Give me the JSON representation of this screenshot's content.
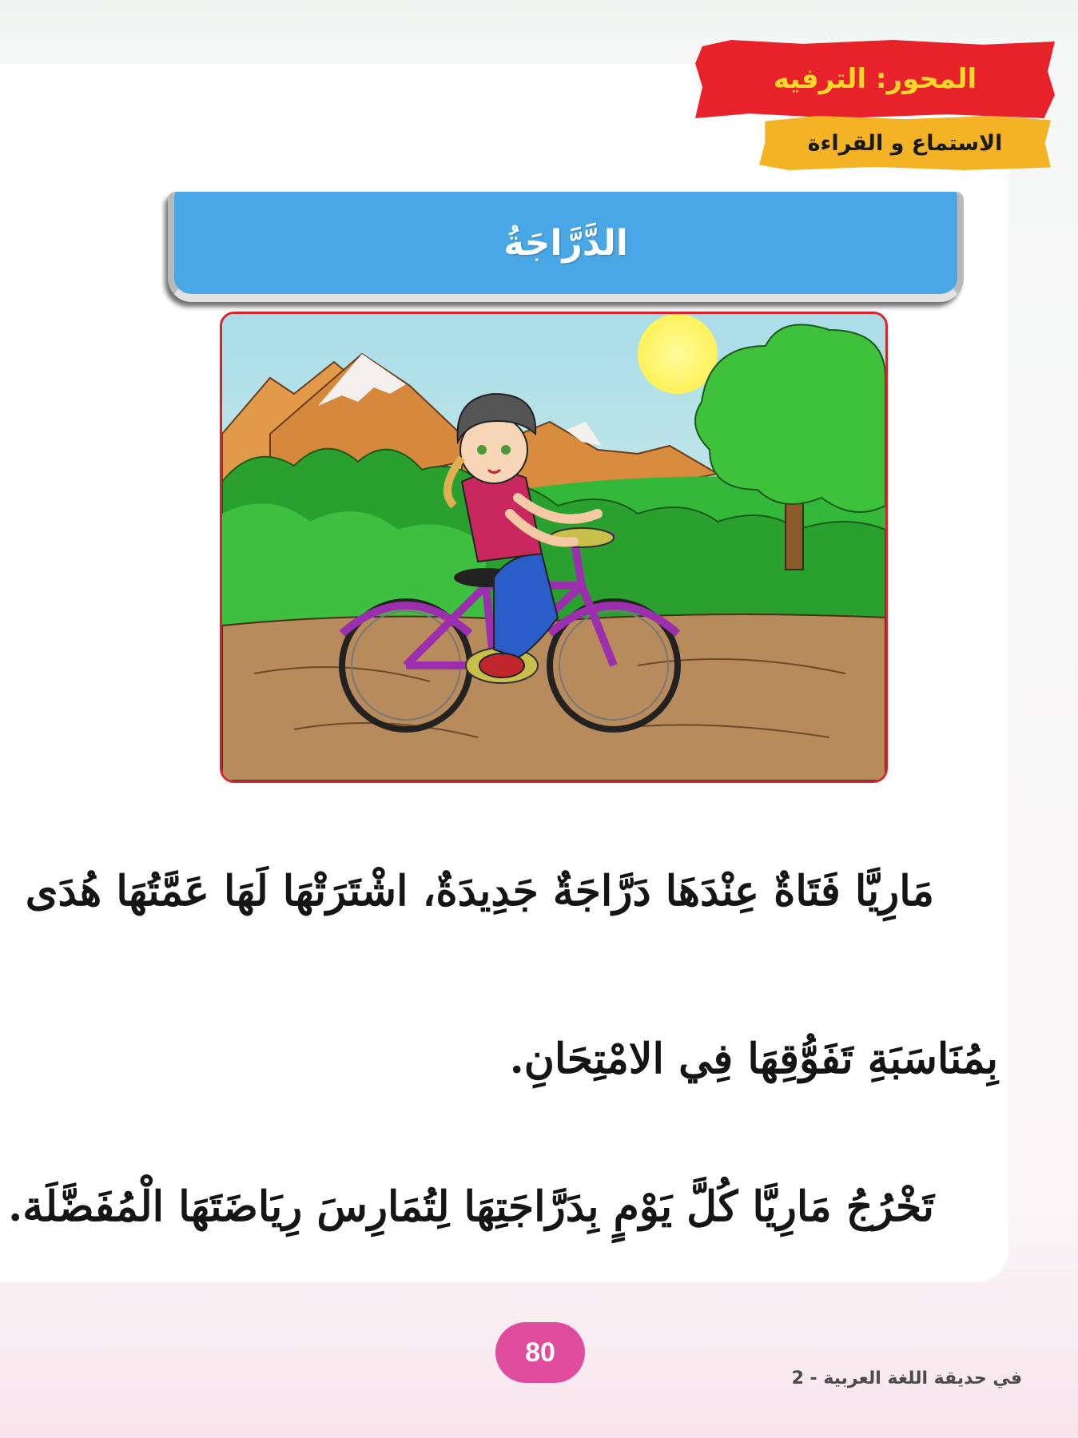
{
  "header": {
    "axis_label": "المحور: الترفيه",
    "skill_label": "الاستماع و القراءة"
  },
  "lesson": {
    "title": "الدَّرَّاجَةُ"
  },
  "illustration": {
    "subject": "girl-riding-bicycle",
    "colors": {
      "sky": "#bfe6ee",
      "sun": "#fff25a",
      "mountain": "#d6883d",
      "snow": "#f4f0ee",
      "grass": "#33b83a",
      "bushes": "#2aa12f",
      "tree": "#3ec23b",
      "road": "#b88b5c",
      "bicycle": "#9b2fae",
      "shirt": "#c8285e",
      "pants": "#2a5dc7"
    }
  },
  "story": {
    "line1": "مَارِيَّا فَتَاةٌ عِنْدَهَا دَرَّاجَةٌ جَدِيدَةٌ، اشْتَرَتْهَا لَهَا عَمَّتُهَا هُدَى",
    "line2": "بِمُنَاسَبَةِ تَفَوُّقِهَا فِي الامْتِحَانِ.",
    "line3": "تَخْرُجُ مَارِيَّا كُلَّ يَوْمٍ بِدَرَّاجَتِهَا لِتُمَارِسَ رِيَاضَتَهَا الْمُفَضَّلَة."
  },
  "footer": {
    "page_number": "80",
    "book_title": "في حديقة اللغة العربية - 2"
  }
}
